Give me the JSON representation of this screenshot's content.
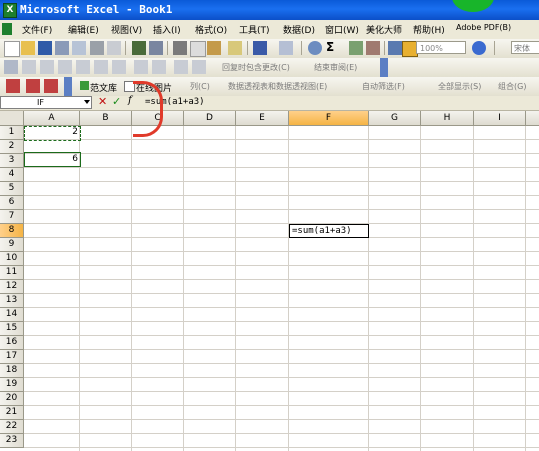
{
  "window": {
    "title": "Microsoft Excel - Book1",
    "app_icon_glyph": "X"
  },
  "menu": [
    "文件(F)",
    "编辑(E)",
    "视图(V)",
    "插入(I)",
    "格式(O)",
    "工具(T)",
    "数据(D)",
    "窗口(W)",
    "美化大师",
    "帮助(H)",
    "Adobe PDF(B)"
  ],
  "toolbar2": {
    "zoom": "100%",
    "font": "宋体"
  },
  "toolbar3": {
    "item_fanwenku": "范文库",
    "item_online_picture": "在线图片",
    "item_column": "列(C)",
    "item_pivot": "数据透视表和数据透视图(E)",
    "item_autofilter": "自动筛选(F)",
    "item_showall": "全部显示(S)",
    "item_group": "组合(G)",
    "item_reply": "回复时包含更改(C)",
    "item_end_review": "结束审阅(E)"
  },
  "formula_bar": {
    "name_box": "IF",
    "formula": "=sum(a1+a3)"
  },
  "columns": [
    "A",
    "B",
    "C",
    "D",
    "E",
    "F",
    "G",
    "H",
    "I"
  ],
  "rows": [
    "1",
    "2",
    "3",
    "4",
    "5",
    "6",
    "7",
    "8",
    "9",
    "10",
    "11",
    "12",
    "13",
    "14",
    "15",
    "16",
    "17",
    "18",
    "19",
    "20",
    "21",
    "22",
    "23"
  ],
  "cells": {
    "A1": "2",
    "A3": "6",
    "F8": "=sum(a1+a3)"
  },
  "colors": {
    "title_bar": "#0a5ad8",
    "active_header": "#f5b445",
    "annotation": "#e03a2a"
  }
}
